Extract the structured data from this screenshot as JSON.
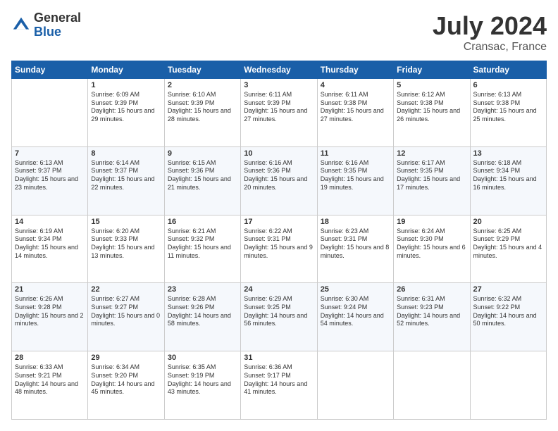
{
  "logo": {
    "general": "General",
    "blue": "Blue"
  },
  "header": {
    "month": "July 2024",
    "location": "Cransac, France"
  },
  "weekdays": [
    "Sunday",
    "Monday",
    "Tuesday",
    "Wednesday",
    "Thursday",
    "Friday",
    "Saturday"
  ],
  "weeks": [
    [
      {
        "day": "",
        "content": ""
      },
      {
        "day": "1",
        "content": "Sunrise: 6:09 AM\nSunset: 9:39 PM\nDaylight: 15 hours\nand 29 minutes."
      },
      {
        "day": "2",
        "content": "Sunrise: 6:10 AM\nSunset: 9:39 PM\nDaylight: 15 hours\nand 28 minutes."
      },
      {
        "day": "3",
        "content": "Sunrise: 6:11 AM\nSunset: 9:39 PM\nDaylight: 15 hours\nand 27 minutes."
      },
      {
        "day": "4",
        "content": "Sunrise: 6:11 AM\nSunset: 9:38 PM\nDaylight: 15 hours\nand 27 minutes."
      },
      {
        "day": "5",
        "content": "Sunrise: 6:12 AM\nSunset: 9:38 PM\nDaylight: 15 hours\nand 26 minutes."
      },
      {
        "day": "6",
        "content": "Sunrise: 6:13 AM\nSunset: 9:38 PM\nDaylight: 15 hours\nand 25 minutes."
      }
    ],
    [
      {
        "day": "7",
        "content": "Sunrise: 6:13 AM\nSunset: 9:37 PM\nDaylight: 15 hours\nand 23 minutes."
      },
      {
        "day": "8",
        "content": "Sunrise: 6:14 AM\nSunset: 9:37 PM\nDaylight: 15 hours\nand 22 minutes."
      },
      {
        "day": "9",
        "content": "Sunrise: 6:15 AM\nSunset: 9:36 PM\nDaylight: 15 hours\nand 21 minutes."
      },
      {
        "day": "10",
        "content": "Sunrise: 6:16 AM\nSunset: 9:36 PM\nDaylight: 15 hours\nand 20 minutes."
      },
      {
        "day": "11",
        "content": "Sunrise: 6:16 AM\nSunset: 9:35 PM\nDaylight: 15 hours\nand 19 minutes."
      },
      {
        "day": "12",
        "content": "Sunrise: 6:17 AM\nSunset: 9:35 PM\nDaylight: 15 hours\nand 17 minutes."
      },
      {
        "day": "13",
        "content": "Sunrise: 6:18 AM\nSunset: 9:34 PM\nDaylight: 15 hours\nand 16 minutes."
      }
    ],
    [
      {
        "day": "14",
        "content": "Sunrise: 6:19 AM\nSunset: 9:34 PM\nDaylight: 15 hours\nand 14 minutes."
      },
      {
        "day": "15",
        "content": "Sunrise: 6:20 AM\nSunset: 9:33 PM\nDaylight: 15 hours\nand 13 minutes."
      },
      {
        "day": "16",
        "content": "Sunrise: 6:21 AM\nSunset: 9:32 PM\nDaylight: 15 hours\nand 11 minutes."
      },
      {
        "day": "17",
        "content": "Sunrise: 6:22 AM\nSunset: 9:31 PM\nDaylight: 15 hours\nand 9 minutes."
      },
      {
        "day": "18",
        "content": "Sunrise: 6:23 AM\nSunset: 9:31 PM\nDaylight: 15 hours\nand 8 minutes."
      },
      {
        "day": "19",
        "content": "Sunrise: 6:24 AM\nSunset: 9:30 PM\nDaylight: 15 hours\nand 6 minutes."
      },
      {
        "day": "20",
        "content": "Sunrise: 6:25 AM\nSunset: 9:29 PM\nDaylight: 15 hours\nand 4 minutes."
      }
    ],
    [
      {
        "day": "21",
        "content": "Sunrise: 6:26 AM\nSunset: 9:28 PM\nDaylight: 15 hours\nand 2 minutes."
      },
      {
        "day": "22",
        "content": "Sunrise: 6:27 AM\nSunset: 9:27 PM\nDaylight: 15 hours\nand 0 minutes."
      },
      {
        "day": "23",
        "content": "Sunrise: 6:28 AM\nSunset: 9:26 PM\nDaylight: 14 hours\nand 58 minutes."
      },
      {
        "day": "24",
        "content": "Sunrise: 6:29 AM\nSunset: 9:25 PM\nDaylight: 14 hours\nand 56 minutes."
      },
      {
        "day": "25",
        "content": "Sunrise: 6:30 AM\nSunset: 9:24 PM\nDaylight: 14 hours\nand 54 minutes."
      },
      {
        "day": "26",
        "content": "Sunrise: 6:31 AM\nSunset: 9:23 PM\nDaylight: 14 hours\nand 52 minutes."
      },
      {
        "day": "27",
        "content": "Sunrise: 6:32 AM\nSunset: 9:22 PM\nDaylight: 14 hours\nand 50 minutes."
      }
    ],
    [
      {
        "day": "28",
        "content": "Sunrise: 6:33 AM\nSunset: 9:21 PM\nDaylight: 14 hours\nand 48 minutes."
      },
      {
        "day": "29",
        "content": "Sunrise: 6:34 AM\nSunset: 9:20 PM\nDaylight: 14 hours\nand 45 minutes."
      },
      {
        "day": "30",
        "content": "Sunrise: 6:35 AM\nSunset: 9:19 PM\nDaylight: 14 hours\nand 43 minutes."
      },
      {
        "day": "31",
        "content": "Sunrise: 6:36 AM\nSunset: 9:17 PM\nDaylight: 14 hours\nand 41 minutes."
      },
      {
        "day": "",
        "content": ""
      },
      {
        "day": "",
        "content": ""
      },
      {
        "day": "",
        "content": ""
      }
    ]
  ]
}
